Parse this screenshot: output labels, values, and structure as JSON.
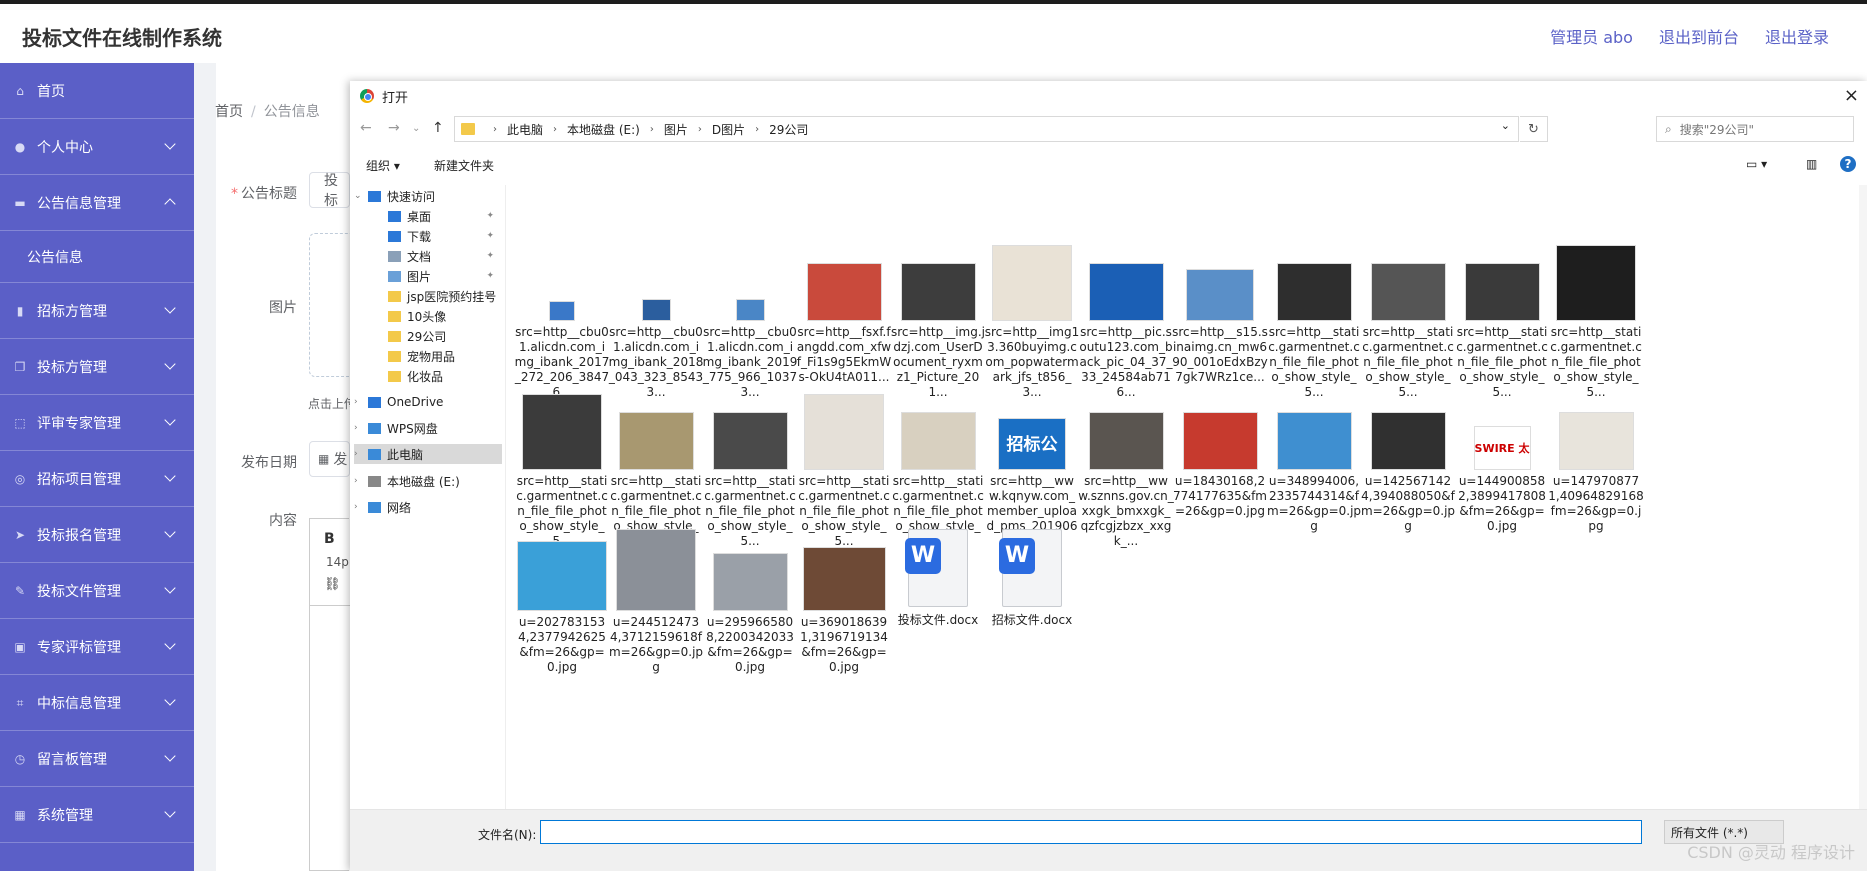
{
  "app": {
    "title": "投标文件在线制作系统"
  },
  "header": {
    "admin": "管理员 abo",
    "to_front": "退出到前台",
    "logout": "退出登录"
  },
  "sidebar": {
    "items": [
      {
        "label": "首页",
        "icon": "home-icon",
        "chev": ""
      },
      {
        "label": "个人中心",
        "icon": "user-icon",
        "chev": "down"
      },
      {
        "label": "公告信息管理",
        "icon": "message-icon",
        "chev": "up"
      },
      {
        "label": "公告信息",
        "icon": "",
        "chev": "",
        "sub": true
      },
      {
        "label": "招标方管理",
        "icon": "chart-icon",
        "chev": "down"
      },
      {
        "label": "投标方管理",
        "icon": "copy-icon",
        "chev": "down"
      },
      {
        "label": "评审专家管理",
        "icon": "scan-icon",
        "chev": "down"
      },
      {
        "label": "招标项目管理",
        "icon": "globe-icon",
        "chev": "down"
      },
      {
        "label": "投标报名管理",
        "icon": "send-icon",
        "chev": "down"
      },
      {
        "label": "投标文件管理",
        "icon": "pen-icon",
        "chev": "down"
      },
      {
        "label": "专家评标管理",
        "icon": "briefcase-icon",
        "chev": "down"
      },
      {
        "label": "中标信息管理",
        "icon": "crop-icon",
        "chev": "down"
      },
      {
        "label": "留言板管理",
        "icon": "clock-icon",
        "chev": "down"
      },
      {
        "label": "系统管理",
        "icon": "grid-icon",
        "chev": "down"
      }
    ]
  },
  "breadcrumb": {
    "home": "首页",
    "current": "公告信息"
  },
  "form": {
    "title_label": "公告标题",
    "title_value": "投标",
    "image_label": "图片",
    "upload_tip": "点击上传",
    "date_label": "发布日期",
    "date_value": "发",
    "content_label": "内容",
    "editor_bold": "B",
    "editor_size": "14p"
  },
  "dialog": {
    "title": "打开",
    "close": "×",
    "path": [
      "此电脑",
      "本地磁盘 (E:)",
      "图片",
      "D图片",
      "29公司"
    ],
    "search_placeholder": "搜索\"29公司\"",
    "organize": "组织 ▾",
    "new_folder": "新建文件夹",
    "tree": [
      {
        "label": "快速访问",
        "kind": "star",
        "exp": "⌄",
        "pin": false
      },
      {
        "label": "桌面",
        "kind": "desktop",
        "exp": "",
        "pin": true
      },
      {
        "label": "下载",
        "kind": "download",
        "exp": "",
        "pin": true
      },
      {
        "label": "文档",
        "kind": "doc",
        "exp": "",
        "pin": true
      },
      {
        "label": "图片",
        "kind": "pic",
        "exp": "",
        "pin": true
      },
      {
        "label": "jsp医院预约挂号",
        "kind": "folder",
        "exp": "",
        "pin": true
      },
      {
        "label": "10头像",
        "kind": "folder",
        "exp": "",
        "pin": false
      },
      {
        "label": "29公司",
        "kind": "folder",
        "exp": "",
        "pin": false
      },
      {
        "label": "宠物用品",
        "kind": "folder",
        "exp": "",
        "pin": false
      },
      {
        "label": "化妆品",
        "kind": "folder",
        "exp": "",
        "pin": false
      },
      {
        "label": "OneDrive",
        "kind": "cloud",
        "exp": "›",
        "pin": false
      },
      {
        "label": "WPS网盘",
        "kind": "cloud2",
        "exp": "›",
        "pin": false
      },
      {
        "label": "此电脑",
        "kind": "pc",
        "exp": "›",
        "pin": false,
        "sel": true
      },
      {
        "label": "本地磁盘 (E:)",
        "kind": "disk",
        "exp": "›",
        "pin": false
      },
      {
        "label": "网络",
        "kind": "net",
        "exp": "›",
        "pin": false
      }
    ],
    "files": [
      {
        "name": "src=http__cbu01.alicdn.com_img_ibank_2017_272_206_38476...",
        "color": "#3a78c8",
        "h": 20
      },
      {
        "name": "src=http__cbu01.alicdn.com_img_ibank_2018_043_323_85433...",
        "color": "#2b5e9e",
        "h": 22
      },
      {
        "name": "src=http__cbu01.alicdn.com_img_ibank_2019_775_966_10373...",
        "color": "#4a86c6",
        "h": 22
      },
      {
        "name": "src=http__fsxf.fangdd.com_xfwf_Fi1s9g5EkmWs-OkU4tA011...",
        "color": "#c94a3c",
        "h": 58
      },
      {
        "name": "src=http__img.jdzj.com_UserDocument_ryxmz1_Picture_201...",
        "color": "#3d3d3d",
        "h": 58
      },
      {
        "name": "src=http__img13.360buyimg.com_popwatermark_jfs_t856_3...",
        "color": "#e9e2d6",
        "h": 76
      },
      {
        "name": "src=http__pic.soutu123.com_back_pic_04_37_33_24584ab716...",
        "color": "#1b5fb5",
        "h": 58
      },
      {
        "name": "src=http__s15.sinaimg.cn_mw690_001oEdxBzy7gk7WRz1ce...",
        "color": "#5a8fc8",
        "h": 52
      },
      {
        "name": "src=http__static.garmentnet.cn_file_file_photo_show_style_5...",
        "color": "#2e2e2e",
        "h": 58
      },
      {
        "name": "src=http__static.garmentnet.cn_file_file_photo_show_style_5...",
        "color": "#555",
        "h": 58
      },
      {
        "name": "src=http__static.garmentnet.cn_file_file_photo_show_style_5...",
        "color": "#3a3a3a",
        "h": 58
      },
      {
        "name": "src=http__static.garmentnet.cn_file_file_photo_show_style_5...",
        "color": "#1e1e1e",
        "h": 76
      },
      {
        "name": "src=http__static.garmentnet.cn_file_file_photo_show_style_5...",
        "color": "#3b3b3b",
        "h": 76
      },
      {
        "name": "src=http__static.garmentnet.cn_file_file_photo_show_style_5...",
        "color": "#a89870",
        "h": 58
      },
      {
        "name": "src=http__static.garmentnet.cn_file_file_photo_show_style_5...",
        "color": "#4a4a4a",
        "h": 58
      },
      {
        "name": "src=http__static.garmentnet.cn_file_file_photo_show_style_5...",
        "color": "#e5e0d8",
        "h": 76
      },
      {
        "name": "src=http__static.garmentnet.cn_file_file_photo_show_style_5...",
        "color": "#d8d0c0",
        "h": 58
      },
      {
        "name": "src=http__www.kqnyw.com_member_upload_pms_201906_2...",
        "color": "#1a6fc4",
        "h": 52,
        "text": "招标公告"
      },
      {
        "name": "src=http__www.sznns.gov.cn_xxgk_bmxxgk_qzfcgjzbzx_xxgk_...",
        "color": "#5a5550",
        "h": 58
      },
      {
        "name": "u=18430168,2774177635&fm=26&gp=0.jpg",
        "color": "#c63a2e",
        "h": 58
      },
      {
        "name": "u=348994006,2335744314&fm=26&gp=0.jpg",
        "color": "#3f8fd0",
        "h": 58
      },
      {
        "name": "u=1425671424,394088050&fm=26&gp=0.jpg",
        "color": "#303030",
        "h": 58
      },
      {
        "name": "u=1449008582,3899417808&fm=26&gp=0.jpg",
        "color": "#ffffff",
        "h": 44,
        "text": "SWIRE 太古集团"
      },
      {
        "name": "u=1479708771,40964829168fm=26&gp=0.jpg",
        "color": "#e8e4dc",
        "h": 58
      },
      {
        "name": "u=2027831534,2377942625&fm=26&gp=0.jpg",
        "color": "#3aa0d8",
        "h": 70
      },
      {
        "name": "u=2445124734,3712159618fm=26&gp=0.jpg",
        "color": "#8b9098",
        "h": 82
      },
      {
        "name": "u=2959665808,2200342033&fm=26&gp=0.jpg",
        "color": "#9aa0a8",
        "h": 58
      },
      {
        "name": "u=3690186391,3196719134&fm=26&gp=0.jpg",
        "color": "#6e4a36",
        "h": 64
      },
      {
        "name": "投标文件.docx",
        "doc": true
      },
      {
        "name": "招标文件.docx",
        "doc": true
      }
    ],
    "filename_label": "文件名(N):",
    "filetype": "所有文件 (*.*)",
    "watermark": "CSDN @灵动 程序设计"
  }
}
